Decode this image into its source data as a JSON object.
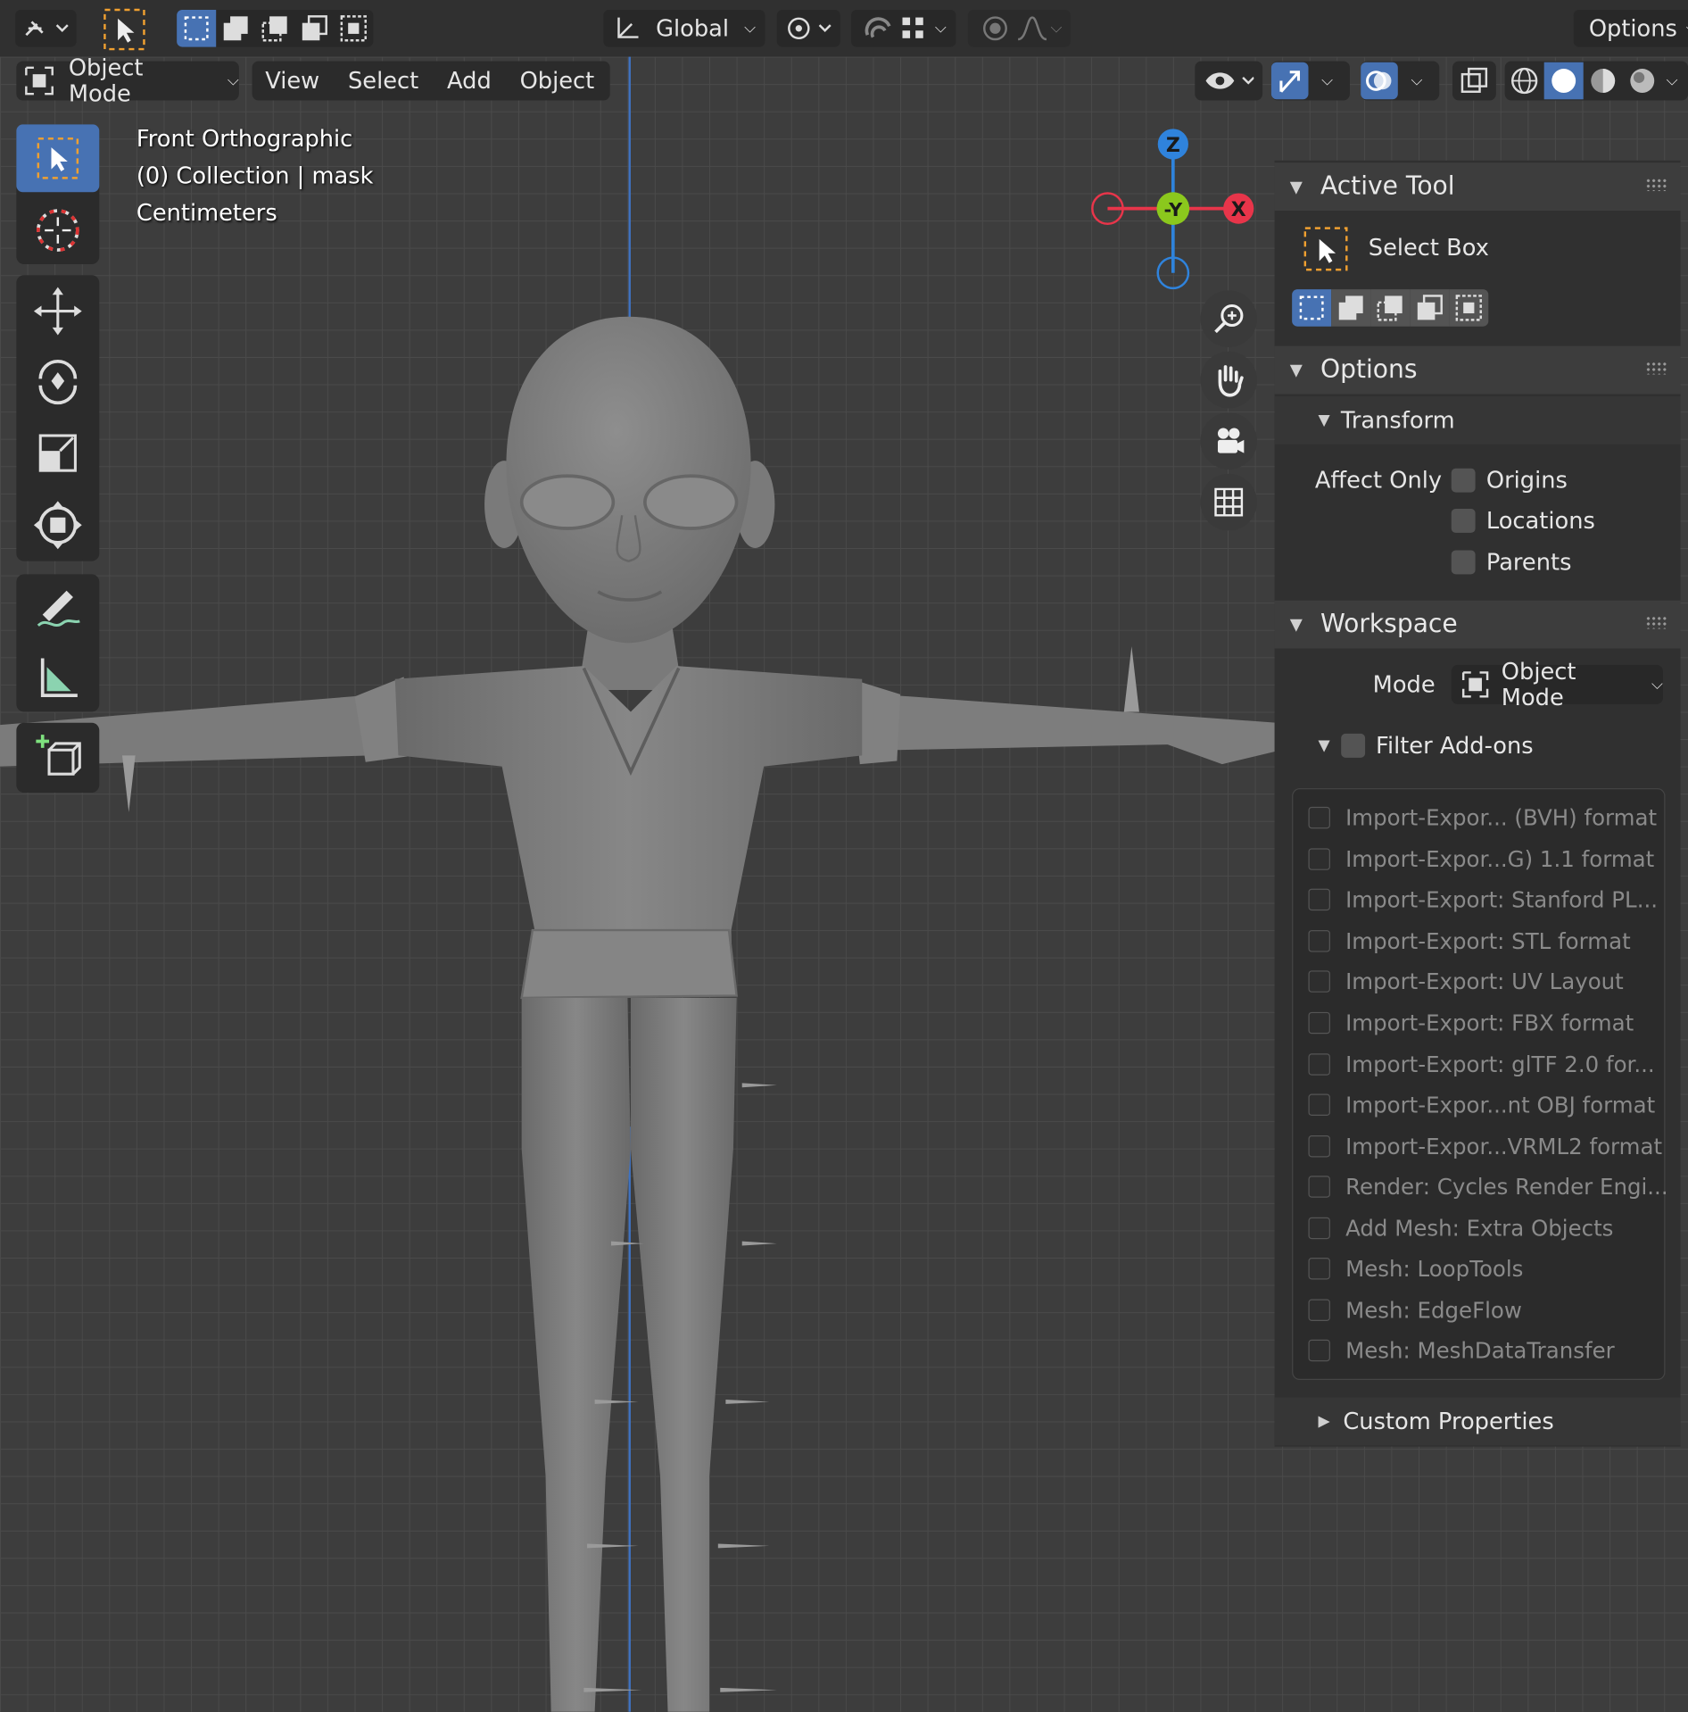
{
  "header": {
    "transform_orientation": "Global",
    "options_label": "Options",
    "mode_label": "Object Mode",
    "menus": [
      "View",
      "Select",
      "Add",
      "Object"
    ]
  },
  "viewport": {
    "view_name": "Front Orthographic",
    "collection_info": "(0) Collection | mask",
    "units": "Centimeters",
    "gizmo_axes": {
      "z": "Z",
      "neg_y": "-Y",
      "x": "X"
    }
  },
  "sidebar": {
    "active_tool": {
      "title": "Active Tool",
      "tool_name": "Select Box"
    },
    "options": {
      "title": "Options",
      "transform_title": "Transform",
      "affect_only_label": "Affect Only",
      "checkboxes": [
        "Origins",
        "Locations",
        "Parents"
      ]
    },
    "workspace": {
      "title": "Workspace",
      "mode_label": "Mode",
      "mode_value": "Object Mode",
      "filter_addons_label": "Filter Add-ons",
      "addons": [
        "Import-Expor... (BVH) format",
        "Import-Expor...G) 1.1 format",
        "Import-Export: Stanford PL...",
        "Import-Export: STL format",
        "Import-Export: UV Layout",
        "Import-Export: FBX format",
        "Import-Export: glTF 2.0 for...",
        "Import-Expor...nt OBJ format",
        "Import-Expor...VRML2 format",
        "Render: Cycles Render Engi...",
        "Add Mesh: Extra Objects",
        "Mesh: LoopTools",
        "Mesh: EdgeFlow",
        "Mesh: MeshDataTransfer"
      ],
      "custom_properties": "Custom Properties"
    }
  },
  "colors": {
    "accent_blue": "#4772b3",
    "axis_x": "#e8354a",
    "axis_y": "#8bc81d",
    "axis_z": "#2f83dc",
    "select_orange": "#f0a030"
  },
  "icons": {
    "toolbar": [
      "select-box-icon",
      "cursor-icon",
      "move-icon",
      "rotate-icon",
      "scale-icon",
      "transform-icon",
      "annotate-icon",
      "measure-icon",
      "add-cube-icon"
    ],
    "navigation": [
      "zoom-icon",
      "hand-pan-icon",
      "camera-icon",
      "grid-ortho-icon"
    ]
  }
}
